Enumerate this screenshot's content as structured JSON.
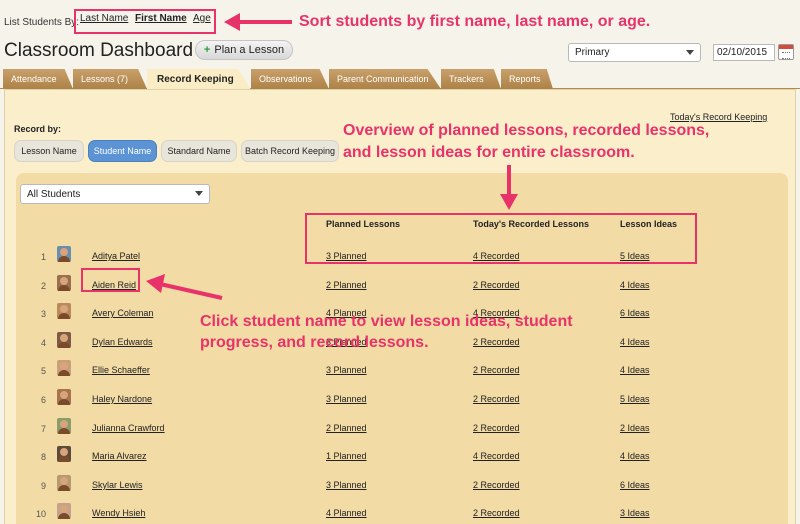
{
  "sort": {
    "label": "List Students By:",
    "options": [
      {
        "label": "Last Name",
        "active": false
      },
      {
        "label": "First Name",
        "active": true
      },
      {
        "label": "Age",
        "active": false
      }
    ]
  },
  "header": {
    "title": "Classroom Dashboard",
    "plan_button": "Plan a Lesson",
    "plan_button_prefix": "+",
    "level_select": "Primary",
    "date": "02/10/2015"
  },
  "tabs": [
    {
      "label": "Attendance",
      "active": false
    },
    {
      "label": "Lessons (7)",
      "active": false
    },
    {
      "label": "Record Keeping",
      "active": true
    },
    {
      "label": "Observations",
      "active": false
    },
    {
      "label": "Parent Communication",
      "active": false
    },
    {
      "label": "Trackers",
      "active": false
    },
    {
      "label": "Reports",
      "active": false
    }
  ],
  "record_keeping": {
    "today_link": "Today's Record Keeping",
    "record_by_label": "Record by:",
    "record_by_options": [
      {
        "label": "Lesson Name",
        "active": false
      },
      {
        "label": "Student Name",
        "active": true
      },
      {
        "label": "Standard Name",
        "active": false
      },
      {
        "label": "Batch Record Keeping",
        "active": false
      }
    ],
    "student_filter": "All Students",
    "columns": {
      "planned": "Planned Lessons",
      "recorded": "Today's Recorded Lessons",
      "ideas": "Lesson Ideas"
    },
    "students": [
      {
        "num": "1",
        "name": "Aditya Patel",
        "planned": "3 Planned",
        "recorded": "4 Recorded",
        "ideas": "5 Ideas"
      },
      {
        "num": "2",
        "name": "Aiden Reid",
        "planned": "2 Planned",
        "recorded": "2 Recorded",
        "ideas": "4 Ideas"
      },
      {
        "num": "3",
        "name": "Avery Coleman",
        "planned": "4 Planned",
        "recorded": "4 Recorded",
        "ideas": "6 Ideas"
      },
      {
        "num": "4",
        "name": "Dylan Edwards",
        "planned": "3 Planned",
        "recorded": "2 Recorded",
        "ideas": "4 Ideas"
      },
      {
        "num": "5",
        "name": "Ellie Schaeffer",
        "planned": "3 Planned",
        "recorded": "2 Recorded",
        "ideas": "4 Ideas"
      },
      {
        "num": "6",
        "name": "Haley Nardone",
        "planned": "3 Planned",
        "recorded": "2 Recorded",
        "ideas": "5 Ideas"
      },
      {
        "num": "7",
        "name": "Julianna Crawford",
        "planned": "2 Planned",
        "recorded": "2 Recorded",
        "ideas": "2 Ideas"
      },
      {
        "num": "8",
        "name": "Maria Alvarez",
        "planned": "1 Planned",
        "recorded": "4 Recorded",
        "ideas": "4 Ideas"
      },
      {
        "num": "9",
        "name": "Skylar Lewis",
        "planned": "3 Planned",
        "recorded": "2 Recorded",
        "ideas": "6 Ideas"
      },
      {
        "num": "10",
        "name": "Wendy Hsieh",
        "planned": "4 Planned",
        "recorded": "2 Recorded",
        "ideas": "3 Ideas"
      }
    ]
  },
  "annotations": {
    "sort_note": "Sort students by first name, last name, or age.",
    "overview_note_line1": "Overview of planned lessons, recorded lessons,",
    "overview_note_line2": "and lesson ideas for entire classroom.",
    "click_note_line1": "Click student name to view lesson ideas, student",
    "click_note_line2": "progress, and record lessons.",
    "color": "#e8326a"
  }
}
